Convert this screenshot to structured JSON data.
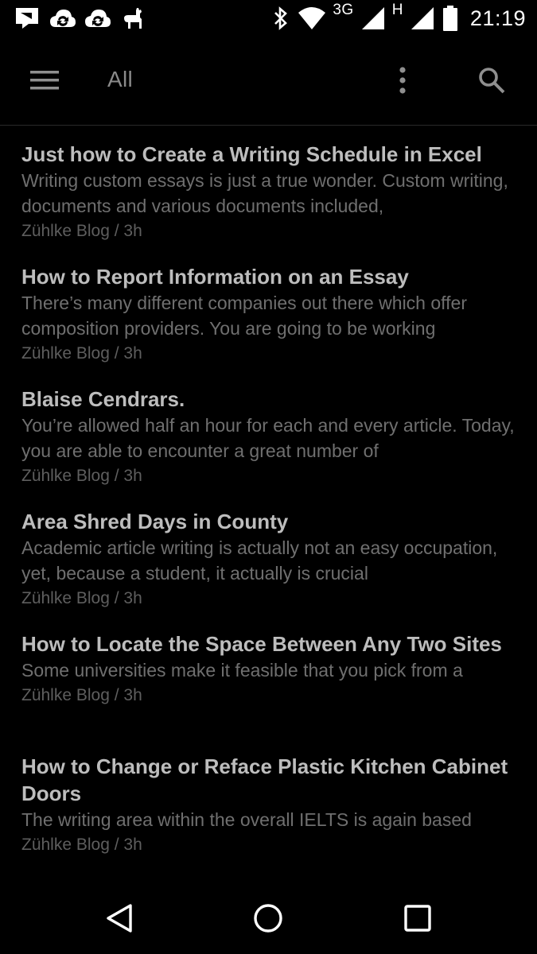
{
  "status_bar": {
    "network_3g": "3G",
    "network_h": "H",
    "time": "21:19",
    "icons": [
      "flag-icon",
      "cloud-sync-icon",
      "cloud-sync-icon",
      "llama-icon",
      "bluetooth-icon",
      "wifi-icon",
      "signal-icon",
      "signal-icon",
      "battery-icon"
    ]
  },
  "app_bar": {
    "title": "All",
    "menu_icon": "hamburger-menu-icon",
    "more_icon": "more-vert-icon",
    "search_icon": "search-icon"
  },
  "articles": [
    {
      "title": "Just how to Create a Writing Schedule in Excel",
      "snippet": "Writing custom essays is just a true wonder. Custom writing, documents and various documents included,",
      "meta": "Zühlke Blog / 3h"
    },
    {
      "title": "How to Report Information on an Essay",
      "snippet": "There’s many different companies out there which offer composition providers. You are going to be working",
      "meta": "Zühlke Blog / 3h"
    },
    {
      "title": "Blaise Cendrars.",
      "snippet": "You’re allowed half an hour for each and every article. Today, you are able to encounter a great number of",
      "meta": "Zühlke Blog / 3h"
    },
    {
      "title": "Area Shred Days in County",
      "snippet": "Academic article writing is actually not an easy occupation, yet, because a student, it actually is crucial",
      "meta": "Zühlke Blog / 3h"
    },
    {
      "title": "How to Locate the Space Between Any Two Sites",
      "snippet": "Some universities make it feasible that you pick from a",
      "meta": "Zühlke Blog / 3h"
    },
    {
      "title": "How to Change or Reface Plastic Kitchen Cabinet Doors",
      "snippet": "The writing area within the overall IELTS is again based",
      "meta": "Zühlke Blog / 3h"
    }
  ],
  "nav_bar": {
    "icons": [
      "back-triangle-icon",
      "home-circle-icon",
      "recents-square-icon"
    ]
  },
  "colors": {
    "background": "#000000",
    "title": "#bdbdbd",
    "snippet": "#6f6f6f",
    "meta": "#5e5e5e",
    "app_title": "#8a8a8a"
  }
}
